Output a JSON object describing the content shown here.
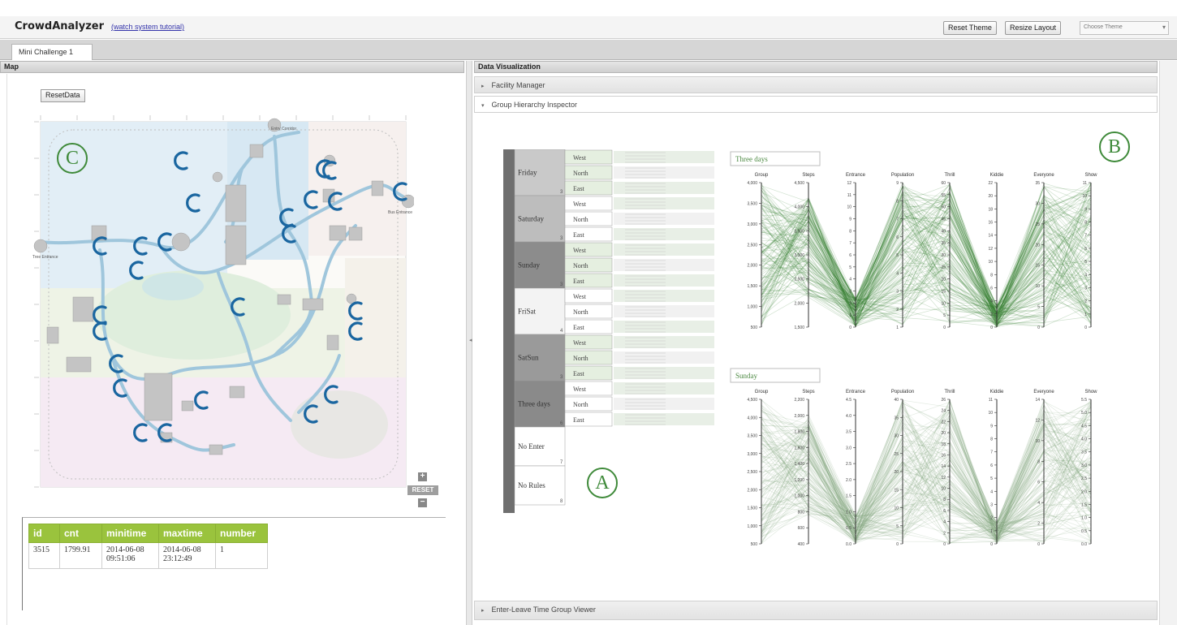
{
  "header": {
    "app_title": "CrowdAnalyzer",
    "tutorial_link": "(watch system tutorial)",
    "reset_theme": "Reset Theme",
    "resize_layout": "Resize Layout",
    "choose_theme": "Choose Theme",
    "caret_icon": "▾"
  },
  "tabs": {
    "active": "Mini Challenge 1"
  },
  "map_panel": {
    "title": "Map",
    "reset_data": "ResetData",
    "zoom_in": "+",
    "zoom_out": "−",
    "zoom_reset": "RESET",
    "entrances": [
      "Entry Corridor",
      "Tree Entrance",
      "Bus Entrance"
    ],
    "result_table": {
      "columns": [
        "id",
        "cnt",
        "minitime",
        "maxtime",
        "number"
      ],
      "rows": [
        [
          "3515",
          "1799.91",
          "2014-06-08 09:51:06",
          "2014-06-08 23:12:49",
          "1"
        ]
      ]
    },
    "colors": {
      "glyph": "#1a66a0",
      "path": "#9fc6dc",
      "table_header": "#9ac33d"
    }
  },
  "dv_panel": {
    "title": "Data Visualization",
    "sections": [
      {
        "label": "Facility Manager",
        "expanded": false
      },
      {
        "label": "Group Hierarchy Inspector",
        "expanded": true
      },
      {
        "label": "Enter-Leave Time Group Viewer",
        "expanded": false
      }
    ],
    "icons": {
      "collapsed": "▸",
      "expanded": "▾"
    }
  },
  "hierarchy": {
    "groups": [
      {
        "name": "Friday",
        "count": "3",
        "subs": [
          "West",
          "North",
          "East"
        ],
        "shade": "#c9c9c9"
      },
      {
        "name": "Saturday",
        "count": "3",
        "subs": [
          "West",
          "North",
          "East"
        ],
        "shade": "#bdbdbd"
      },
      {
        "name": "Sunday",
        "count": "3",
        "subs": [
          "West",
          "North",
          "East"
        ],
        "shade": "#8c8c8c"
      },
      {
        "name": "FriSat",
        "count": "4",
        "subs": [
          "West",
          "North",
          "East"
        ],
        "shade": "#f3f3f3"
      },
      {
        "name": "SatSun",
        "count": "3",
        "subs": [
          "West",
          "North",
          "East"
        ],
        "shade": "#9a9a9a"
      },
      {
        "name": "Three days",
        "count": "6",
        "subs": [
          "West",
          "North",
          "East"
        ],
        "shade": "#8a8a8a"
      },
      {
        "name": "No Enter",
        "count": "7",
        "subs": [],
        "shade": "#ffffff"
      },
      {
        "name": "No Rules",
        "count": "8",
        "subs": [],
        "shade": "#ffffff"
      }
    ]
  },
  "labels": {
    "a": "A",
    "b": "B",
    "c": "C"
  },
  "chart_data": [
    {
      "type": "parallel-coordinates",
      "title": "Three days",
      "color": "#2e7d2a",
      "axes": [
        {
          "name": "Group",
          "ticks": [
            "500",
            "1,000",
            "1,500",
            "2,000",
            "2,500",
            "3,000",
            "3,500",
            "4,000"
          ]
        },
        {
          "name": "Steps",
          "ticks": [
            "1,500",
            "2,000",
            "2,500",
            "3,000",
            "3,500",
            "4,000",
            "4,500"
          ]
        },
        {
          "name": "Entrance",
          "ticks": [
            "0",
            "1",
            "2",
            "3",
            "4",
            "5",
            "6",
            "7",
            "8",
            "9",
            "10",
            "11",
            "12"
          ]
        },
        {
          "name": "Population",
          "ticks": [
            "1",
            "2",
            "3",
            "4",
            "5",
            "6",
            "7",
            "8",
            "9"
          ]
        },
        {
          "name": "Thrill",
          "ticks": [
            "0",
            "5",
            "10",
            "15",
            "20",
            "25",
            "30",
            "35",
            "40",
            "45",
            "50",
            "55",
            "60"
          ]
        },
        {
          "name": "Kiddie",
          "ticks": [
            "0",
            "2",
            "4",
            "6",
            "8",
            "10",
            "12",
            "14",
            "16",
            "18",
            "20",
            "22"
          ]
        },
        {
          "name": "Everyone",
          "ticks": [
            "0",
            "5",
            "10",
            "15",
            "20",
            "25",
            "30",
            "35"
          ]
        },
        {
          "name": "Show",
          "ticks": [
            "0",
            "1",
            "2",
            "3",
            "4",
            "5",
            "6",
            "7",
            "8",
            "9",
            "10",
            "11"
          ]
        }
      ]
    },
    {
      "type": "parallel-coordinates",
      "title": "Sunday",
      "color": "#7fa37a",
      "axes": [
        {
          "name": "Group",
          "ticks": [
            "500",
            "1,000",
            "1,500",
            "2,000",
            "2,500",
            "3,000",
            "3,500",
            "4,000",
            "4,500"
          ]
        },
        {
          "name": "Steps",
          "ticks": [
            "400",
            "600",
            "800",
            "1,000",
            "1,200",
            "1,400",
            "1,600",
            "1,800",
            "2,000",
            "2,200"
          ]
        },
        {
          "name": "Entrance",
          "ticks": [
            "0.0",
            "0.5",
            "1.0",
            "1.5",
            "2.0",
            "2.5",
            "3.0",
            "3.5",
            "4.0",
            "4.5"
          ]
        },
        {
          "name": "Population",
          "ticks": [
            "0",
            "5",
            "10",
            "15",
            "20",
            "25",
            "30",
            "35",
            "40"
          ]
        },
        {
          "name": "Thrill",
          "ticks": [
            "0",
            "2",
            "4",
            "6",
            "8",
            "10",
            "12",
            "14",
            "16",
            "18",
            "20",
            "22",
            "24",
            "26"
          ]
        },
        {
          "name": "Kiddie",
          "ticks": [
            "0",
            "1",
            "2",
            "3",
            "4",
            "5",
            "6",
            "7",
            "8",
            "9",
            "10",
            "11"
          ]
        },
        {
          "name": "Everyone",
          "ticks": [
            "0",
            "2",
            "4",
            "6",
            "8",
            "10",
            "12",
            "14"
          ]
        },
        {
          "name": "Show",
          "ticks": [
            "0.0",
            "0.5",
            "1.0",
            "1.5",
            "2.0",
            "2.5",
            "3.0",
            "3.5",
            "4.0",
            "4.5",
            "5.0",
            "5.5"
          ]
        }
      ]
    }
  ]
}
